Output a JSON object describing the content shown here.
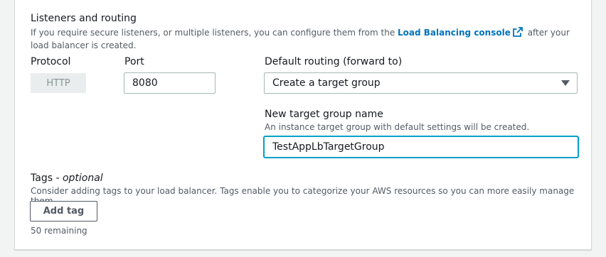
{
  "section": {
    "title": "Listeners and routing",
    "description_before_link": "If you require secure listeners, or multiple listeners, you can configure them from the ",
    "link_text": "Load Balancing console",
    "description_after_link": " after your load balancer is created."
  },
  "protocol": {
    "label": "Protocol",
    "value": "HTTP"
  },
  "port": {
    "label": "Port",
    "value": "8080"
  },
  "default_routing": {
    "label": "Default routing (forward to)",
    "selected": "Create a target group"
  },
  "new_target_group": {
    "label": "New target group name",
    "description": "An instance target group with default settings will be created.",
    "value": "TestAppLbTargetGroup"
  },
  "tags": {
    "label": "Tags",
    "label_suffix": " - ",
    "optional": "optional",
    "description": "Consider adding tags to your load balancer. Tags enable you to categorize your AWS resources so you can more easily manage them.",
    "add_button": "Add tag",
    "remaining": "50 remaining"
  },
  "icons": {
    "external_link": "external-link-icon",
    "dropdown": "caret-down-icon"
  },
  "colors": {
    "link": "#0073bb",
    "focus": "#00a1c9",
    "text": "#16191f",
    "muted": "#545b64"
  }
}
